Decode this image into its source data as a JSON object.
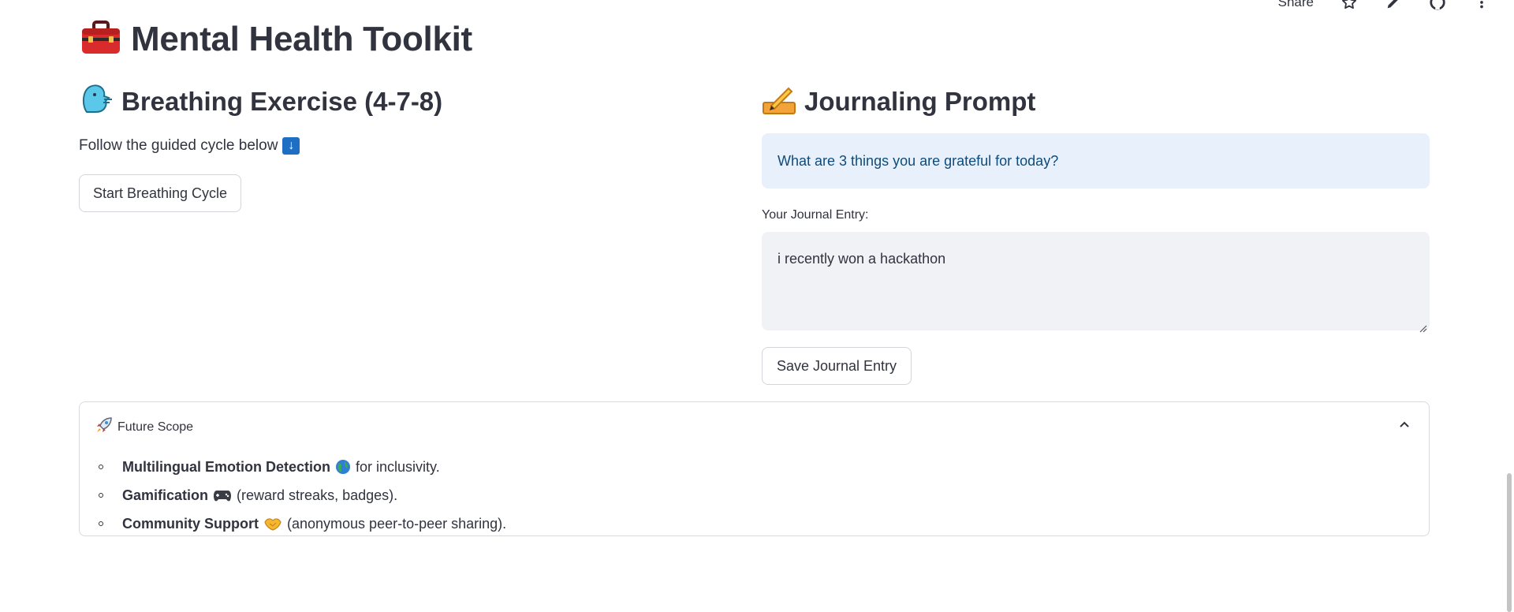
{
  "toolbar": {
    "share_label": "Share"
  },
  "header": {
    "title": "Mental Health Toolkit",
    "title_icon": "toolbox-icon"
  },
  "breathing": {
    "heading": "Breathing Exercise (4-7-8)",
    "heading_icon": "wind-face-icon",
    "instruction": "Follow the guided cycle below",
    "instruction_icon": "down-arrow-icon",
    "button_label": "Start Breathing Cycle"
  },
  "journal": {
    "heading": "Journaling Prompt",
    "heading_icon": "writing-hand-icon",
    "prompt": "What are 3 things you are grateful for today?",
    "entry_label": "Your Journal Entry:",
    "entry_value": "i recently won a hackathon",
    "save_label": "Save Journal Entry"
  },
  "future_scope": {
    "title": "Future Scope",
    "title_icon": "rocket-icon",
    "expanded": true,
    "items": [
      {
        "bold": "Multilingual Emotion Detection",
        "icon": "globe-icon",
        "text": "for inclusivity."
      },
      {
        "bold": "Gamification",
        "icon": "gamepad-icon",
        "text": "(reward streaks, badges)."
      },
      {
        "bold": "Community Support",
        "icon": "handshake-icon",
        "text": "(anonymous peer-to-peer sharing)."
      }
    ]
  },
  "colors": {
    "info_bg": "#e8f1fb",
    "info_text": "#0e4b7d",
    "textarea_bg": "#f0f2f6",
    "text": "#31333f"
  }
}
